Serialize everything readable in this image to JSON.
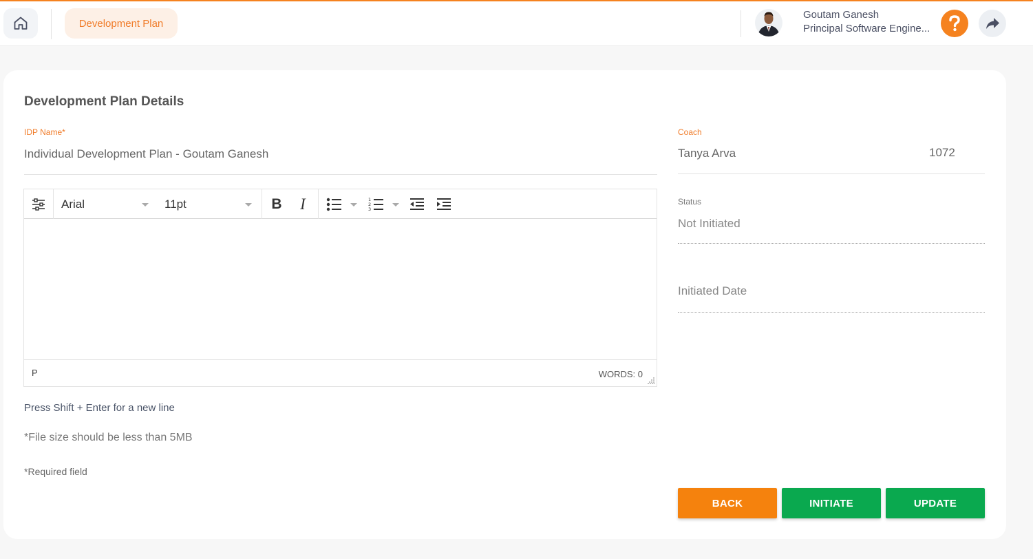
{
  "header": {
    "breadcrumb": "Development Plan",
    "user_name": "Goutam Ganesh",
    "user_role": "Principal Software Engine...",
    "icons": [
      "home-icon",
      "avatar",
      "help-icon",
      "share-icon"
    ]
  },
  "form": {
    "title": "Development Plan Details",
    "idp_label": "IDP Name",
    "required_mark": "*",
    "idp_value": "Individual Development Plan - Goutam Ganesh",
    "coach_label": "Coach",
    "coach_name": "Tanya Arva",
    "coach_id": "1072",
    "status_label": "Status",
    "status_value": "Not Initiated",
    "initiated_date_placeholder": "Initiated Date"
  },
  "editor": {
    "font_family": "Arial",
    "font_size": "11pt",
    "bold_label": "B",
    "italic_label": "I",
    "path": "P",
    "word_count": "WORDS: 0"
  },
  "notes": {
    "shift_enter": "Press Shift + Enter for a new line",
    "file_size": "*File size should be less than 5MB",
    "required_mark": "*",
    "required": "Required field"
  },
  "buttons": {
    "back": "BACK",
    "initiate": "INITIATE",
    "update": "UPDATE"
  },
  "colors": {
    "accent": "#f5821f",
    "back_button": "#f5820d",
    "green_button": "#0aa94f"
  }
}
